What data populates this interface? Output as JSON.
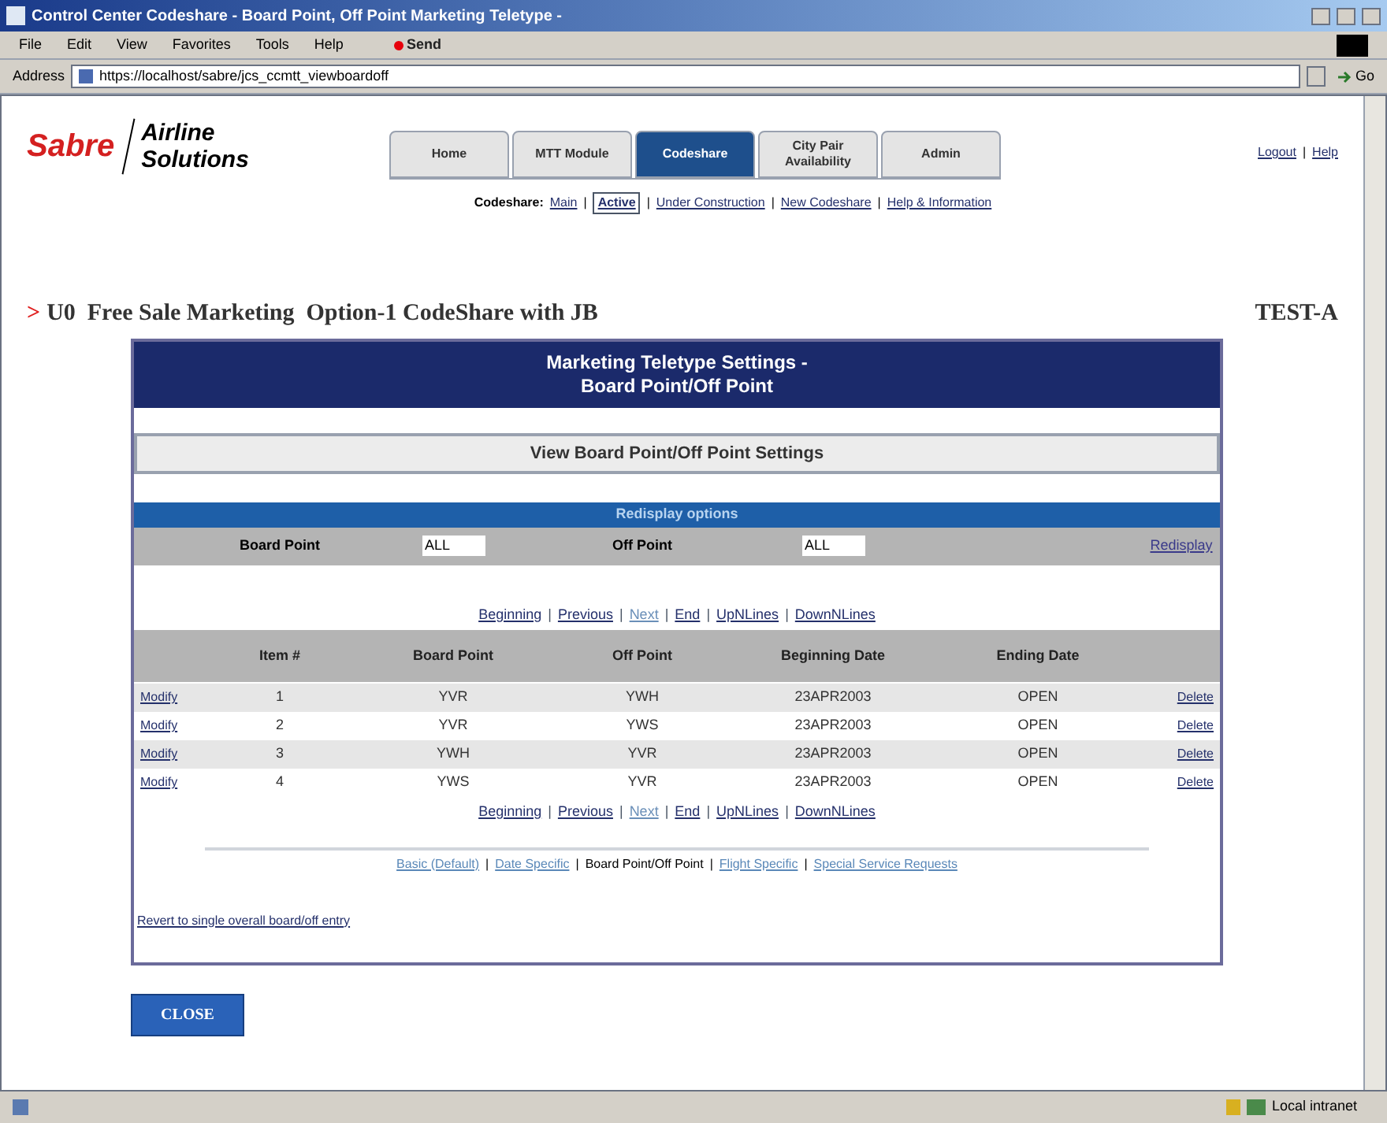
{
  "window": {
    "title": "Control Center Codeshare - Board Point, Off Point Marketing Teletype -"
  },
  "menu": [
    "File",
    "Edit",
    "View",
    "Favorites",
    "Tools",
    "Help"
  ],
  "send_button": "Send",
  "address_bar": {
    "label": "Address",
    "value": "https://localhost/sabre/jcs_ccmtt_viewboardoff",
    "go": "Go"
  },
  "logo": {
    "brand": "Sabre",
    "line_1": "Airline",
    "line_2": "Solutions"
  },
  "tabs": [
    {
      "label": "Home",
      "selected": false
    },
    {
      "label": "MTT Module",
      "selected": false
    },
    {
      "label": "Codeshare",
      "selected": true
    },
    {
      "label": "City Pair Availability",
      "selected": false
    },
    {
      "label": "Admin",
      "selected": false
    }
  ],
  "top_links": {
    "separator": "|",
    "links": [
      "Logout",
      "Help"
    ]
  },
  "subnav": {
    "label": "Codeshare:",
    "separator": "|",
    "items": [
      {
        "label": "Main",
        "selected": false
      },
      {
        "label": "Active",
        "selected": true
      },
      {
        "label": "Under Construction",
        "selected": false
      },
      {
        "label": "New Codeshare",
        "selected": false
      },
      {
        "label": "Help & Information",
        "selected": false
      }
    ]
  },
  "page_heading": {
    "marker": ">",
    "text": "U0  Free Sale Marketing  Option-1 CodeShare with JB",
    "env": "TEST-A"
  },
  "panel": {
    "title_1": "Marketing Teletype Settings -",
    "title_2": "Board Point/Off Point",
    "section": "View Board Point/Off Point Settings",
    "redisplay_heading": "Redisplay options",
    "board_point": {
      "label": "Board Point",
      "value": "ALL"
    },
    "off_point": {
      "label": "Off Point",
      "value": "ALL"
    },
    "redisplay_link": "Redisplay",
    "pager": {
      "separator": "|",
      "links": [
        {
          "label": "Beginning",
          "visited": false
        },
        {
          "label": "Previous",
          "visited": false
        },
        {
          "label": "Next",
          "visited": true
        },
        {
          "label": "End",
          "visited": false
        },
        {
          "label": "UpNLines",
          "visited": false
        },
        {
          "label": "DownNLines",
          "visited": false
        }
      ]
    },
    "table": {
      "columns": [
        "Item #",
        "Board Point",
        "Off Point",
        "Beginning Date",
        "Ending Date"
      ],
      "rows": [
        {
          "modify": "Modify",
          "item": "1",
          "board": "YVR",
          "off": "YWH",
          "begin": "23APR2003",
          "end": "OPEN",
          "delete": "Delete"
        },
        {
          "modify": "Modify",
          "item": "2",
          "board": "YVR",
          "off": "YWS",
          "begin": "23APR2003",
          "end": "OPEN",
          "delete": "Delete"
        },
        {
          "modify": "Modify",
          "item": "3",
          "board": "YWH",
          "off": "YVR",
          "begin": "23APR2003",
          "end": "OPEN",
          "delete": "Delete"
        },
        {
          "modify": "Modify",
          "item": "4",
          "board": "YWS",
          "off": "YVR",
          "begin": "23APR2003",
          "end": "OPEN",
          "delete": "Delete"
        }
      ]
    },
    "pager_bottom": {
      "separator": "|",
      "links": [
        {
          "label": "Beginning",
          "visited": false
        },
        {
          "label": "Previous",
          "visited": false
        },
        {
          "label": "Next",
          "visited": true
        },
        {
          "label": "End",
          "visited": false
        },
        {
          "label": "UpNLines",
          "visited": false
        },
        {
          "label": "DownNLines",
          "visited": false
        }
      ]
    },
    "settings_nav_separator": "|",
    "settings_nav": [
      {
        "label": "Basic (Default)",
        "selected": false
      },
      {
        "label": "Date Specific",
        "selected": false
      },
      {
        "label": "Board Point/Off Point",
        "selected": true
      },
      {
        "label": "Flight Specific",
        "selected": false
      },
      {
        "label": "Special Service Requests",
        "selected": false
      }
    ],
    "revert_link": "Revert to single overall board/off entry"
  },
  "close_button": "CLOSE",
  "status_bar": {
    "zone": "Local intranet"
  }
}
